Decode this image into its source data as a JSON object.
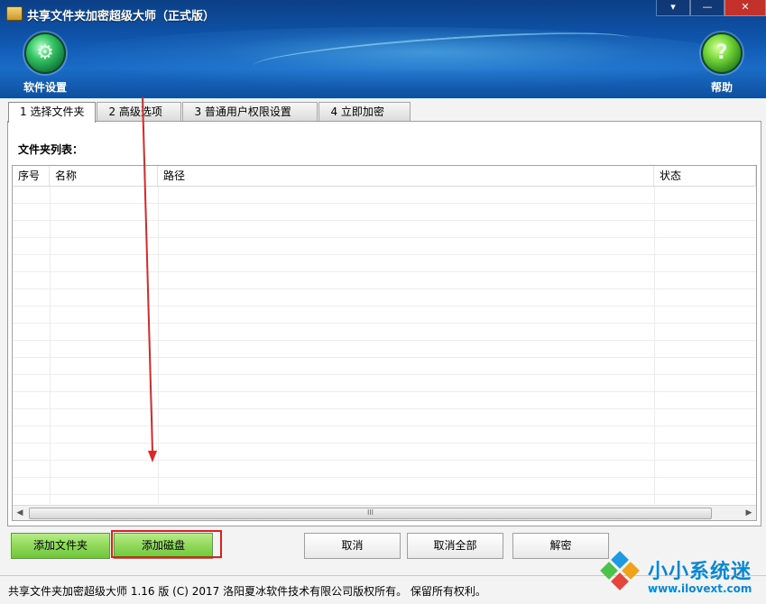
{
  "window": {
    "title": "共享文件夹加密超级大师（正式版）",
    "controls": {
      "menu": "▾",
      "minimize": "—",
      "close": "✕"
    }
  },
  "toolbar": {
    "settings": {
      "label": "软件设置",
      "icon": "gear-icon"
    },
    "help": {
      "label": "帮助",
      "icon": "help-icon"
    }
  },
  "tabs": [
    {
      "label": "1 选择文件夹",
      "active": true
    },
    {
      "label": "2 高级选项",
      "active": false
    },
    {
      "label": "3 普通用户权限设置",
      "active": false
    },
    {
      "label": "4 立即加密",
      "active": false
    }
  ],
  "folder_list": {
    "label": "文件夹列表：",
    "columns": [
      "序号",
      "名称",
      "路径",
      "状态"
    ],
    "rows": []
  },
  "scrollbar": {
    "left_arrow": "◀",
    "right_arrow": "▶",
    "grip": "III"
  },
  "buttons": {
    "add_folder": "添加文件夹",
    "add_disk": "添加磁盘",
    "cancel": "取消",
    "cancel_all": "取消全部",
    "decrypt": "解密"
  },
  "status_bar": {
    "text": "共享文件夹加密超级大师 1.16 版  (C)  2017 洛阳夏冰软件技术有限公司版权所有。 保留所有权利。"
  },
  "watermark": {
    "name": "小小系统迷",
    "url": "www.ilovext.com",
    "colors": [
      "#1e9be0",
      "#4cc24a",
      "#f0a21a",
      "#e5463c"
    ]
  },
  "colors": {
    "header": "#0f55ad",
    "green_button": "#8fd85a",
    "highlight_border": "#e02020",
    "annotation_arrow": "#d42a2a"
  }
}
